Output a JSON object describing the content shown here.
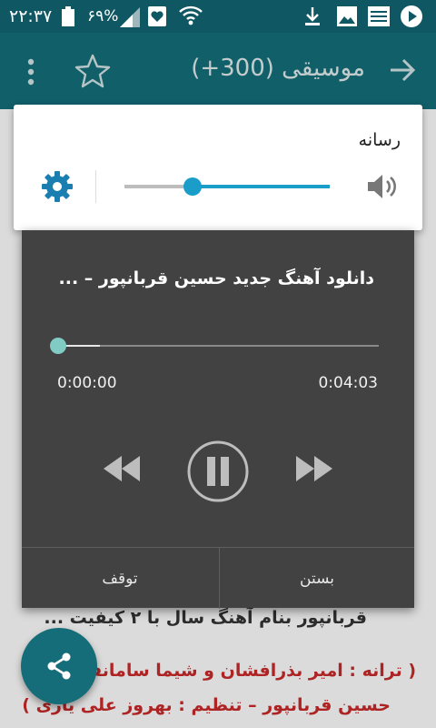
{
  "status_bar": {
    "time": "۲۲:۳۷",
    "battery_percent": "۶۹%"
  },
  "app_bar": {
    "title": "موسیقی (300+)"
  },
  "background_text": {
    "line1": "قربانپور بنام آهنگ سال با ۲ کیفیت ...",
    "line2": "( ترانه : امیر بذرافشان و شیما سامانفر –",
    "line3": "حسین قربانپور – تنظیم : بهروز علی یاری )"
  },
  "volume_panel": {
    "label": "رسانه",
    "level": 0.33
  },
  "player": {
    "song_title": "دانلود آهنگ جدید حسین قربانپور – ...",
    "current_time": "0:00:00",
    "duration": "0:04:03",
    "progress": 0.0,
    "buffered": 0.13,
    "stop_label": "توقف",
    "close_label": "بستن"
  },
  "colors": {
    "primary": "#146d78",
    "accent": "#1a9dc9",
    "player_bg": "#424242"
  }
}
